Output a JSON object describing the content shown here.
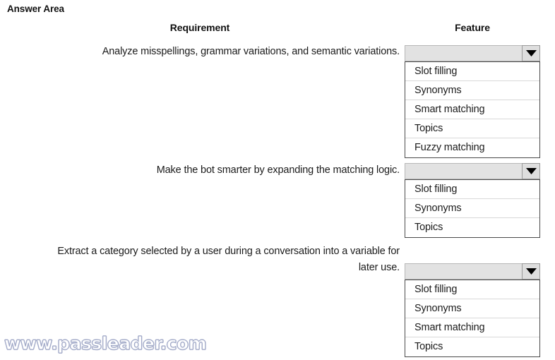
{
  "page": {
    "title": "Answer Area",
    "watermark": "www.passleader.com"
  },
  "columns": {
    "requirement_header": "Requirement",
    "feature_header": "Feature"
  },
  "colors": {
    "dropdown_header_bg": "#e2e2e2",
    "dropdown_button_bg": "#dedede",
    "list_border": "#4a4a4a",
    "row_divider": "#d8d8d8",
    "text": "#1b1b1b",
    "watermark": "#b9bfd6"
  },
  "rows": [
    {
      "requirement": "Analyze misspellings, grammar variations, and semantic variations.",
      "dropdown": {
        "selected": "",
        "placeholder": "",
        "arrow_icon": "chevron-down-icon",
        "expanded": true,
        "options": [
          "Slot filling",
          "Synonyms",
          "Smart matching",
          "Topics",
          "Fuzzy matching"
        ]
      }
    },
    {
      "requirement": "Make the bot smarter by expanding the matching logic.",
      "dropdown": {
        "selected": "",
        "placeholder": "",
        "arrow_icon": "chevron-down-icon",
        "expanded": true,
        "options": [
          "Slot filling",
          "Synonyms",
          "Topics"
        ]
      }
    },
    {
      "requirement": "Extract a category selected by a user during a conversation into a variable for later use.",
      "dropdown": {
        "selected": "",
        "placeholder": "",
        "arrow_icon": "chevron-down-icon",
        "expanded": true,
        "options": [
          "Slot filling",
          "Synonyms",
          "Smart matching",
          "Topics"
        ]
      }
    }
  ]
}
